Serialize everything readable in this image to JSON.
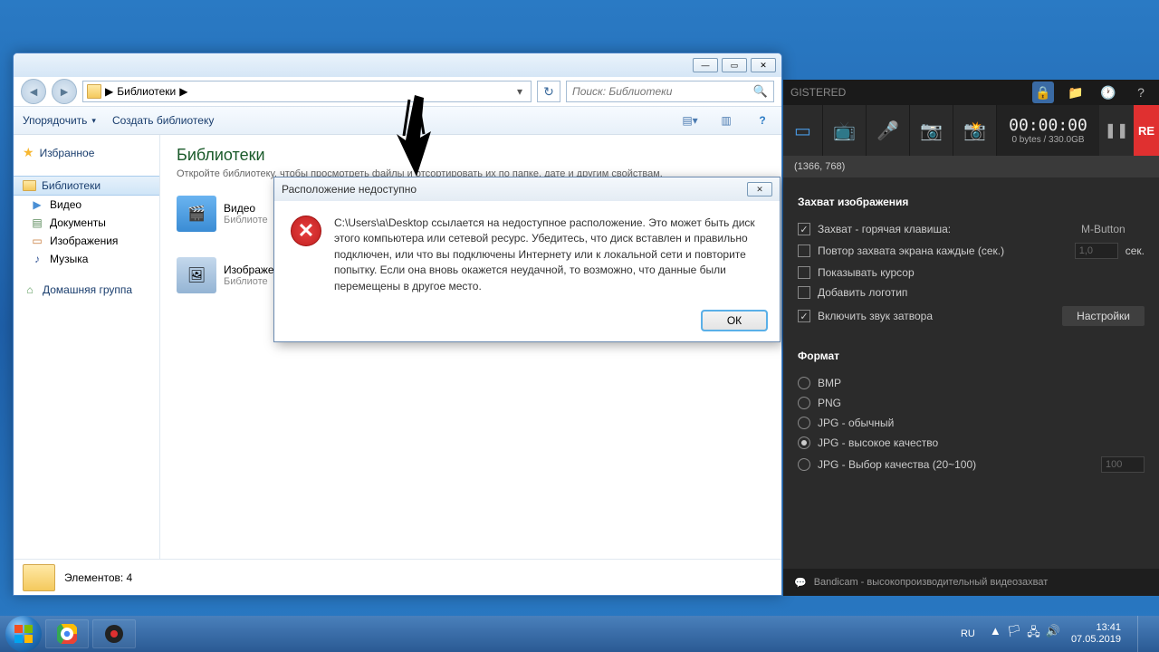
{
  "explorer": {
    "breadcrumb": "Библиотеки",
    "breadcrumb_sep": "▶",
    "search_placeholder": "Поиск: Библиотеки",
    "toolbar": {
      "organize": "Упорядочить",
      "new_lib": "Создать библиотеку"
    },
    "nav": {
      "favorites": "Избранное",
      "libraries": "Библиотеки",
      "video": "Видео",
      "documents": "Документы",
      "images": "Изображения",
      "music": "Музыка",
      "homegroup": "Домашняя группа"
    },
    "content": {
      "title": "Библиотеки",
      "subtitle": "Откройте библиотеку, чтобы просмотреть файлы и отсортировать их по папке, дате и другим свойствам.",
      "items": [
        {
          "name": "Видео",
          "sub": "Библиоте"
        },
        {
          "name": "Изображе",
          "sub": "Библиоте"
        }
      ]
    },
    "status": "Элементов: 4"
  },
  "dialog": {
    "title": "Расположение недоступно",
    "message": "C:\\Users\\a\\Desktop ссылается на недоступное расположение. Это может быть диск этого компьютера или сетевой ресурс. Убедитесь, что диск вставлен и правильно подключен, или что вы подключены Интернету или к локальной сети и повторите попытку. Если она вновь окажется неудачной, то возможно, что данные были перемещены в другое место.",
    "ok": "ОК"
  },
  "bandicam": {
    "registered": "GISTERED",
    "timer": "00:00:00",
    "bytes": "0 bytes / 330.0GB",
    "record_label": "RE",
    "resolution": "(1366, 768)",
    "section_capture": "Захват изображения",
    "rows": {
      "hotkey_label": "Захват - горячая клавиша:",
      "hotkey_val": "M-Button",
      "repeat_label": "Повтор захвата экрана каждые (сек.)",
      "repeat_val": "1,0",
      "repeat_unit": "сек.",
      "cursor_label": "Показывать курсор",
      "logo_label": "Добавить логотип",
      "shutter_label": "Включить звук затвора",
      "settings_btn": "Настройки"
    },
    "section_format": "Формат",
    "formats": {
      "bmp": "BMP",
      "png": "PNG",
      "jpg_normal": "JPG - обычный",
      "jpg_high": "JPG - высокое качество",
      "jpg_custom": "JPG - Выбор качества (20~100)",
      "jpg_custom_val": "100"
    },
    "footer": "Bandicam - высокопроизводительный видеозахват"
  },
  "taskbar": {
    "lang": "RU",
    "time": "13:41",
    "date": "07.05.2019"
  }
}
